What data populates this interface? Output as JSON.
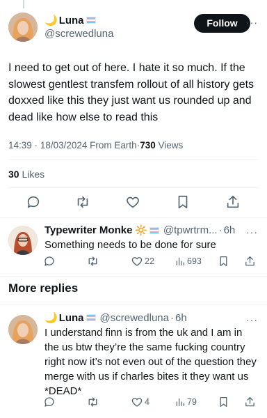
{
  "main_tweet": {
    "display_name": "Luna",
    "handle": "@screwedluna",
    "follow_label": "Follow",
    "more_label": "···",
    "text": "I need to get out of here. I hate it so much. If the slowest gentlest transfem rollout of all history gets doxxed like this they just want us rounded up and dead like how else to read this",
    "time": "14:39",
    "date": "18/03/2024",
    "source": "From Earth",
    "views_count": "730",
    "views_label": "Views",
    "likes_count": "30",
    "likes_label": "Likes",
    "sep": "·"
  },
  "reply1": {
    "display_name": "Typewriter Monke",
    "handle": "@tpwrtrm...",
    "time": "6h",
    "sep": "·",
    "text": "Something needs to be done for sure",
    "likes": "22",
    "views": "693",
    "more_label": "···"
  },
  "more_replies_label": "More replies",
  "reply2": {
    "display_name": "Luna",
    "handle": "@screwedluna",
    "time": "6h",
    "sep": "·",
    "text": "I understand finn is from the uk and I am in the us btw they’re the same fucking country right now it’s not even out of the question they merge with us if charles bites it they want us *DEAD*",
    "likes": "4",
    "views": "79",
    "more_label": "···"
  },
  "icons": [
    "reply-icon",
    "retweet-icon",
    "like-icon",
    "bookmark-icon",
    "share-icon",
    "views-icon",
    "moon-emoji",
    "sun-emoji",
    "trans-flag-emoji"
  ],
  "colors": {
    "text": "#0f1419",
    "secondary": "#536471",
    "divider": "#eff3f4",
    "follow_bg": "#0f1419"
  }
}
